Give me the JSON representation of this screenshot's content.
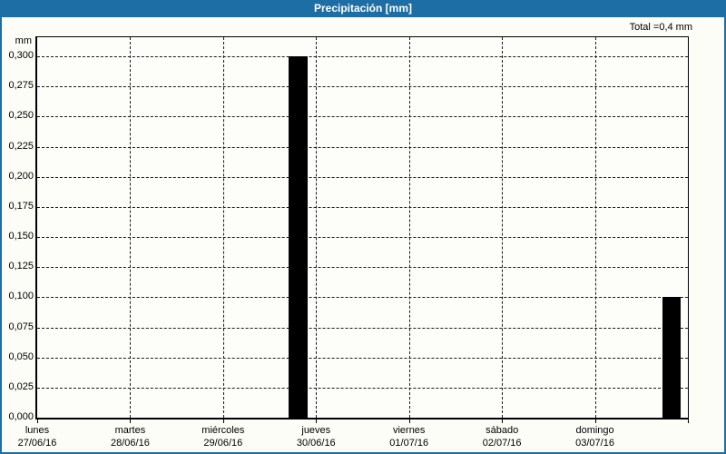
{
  "window": {
    "title": "Precipitación [mm]"
  },
  "colors": {
    "frame_blue": "#1c6ea4",
    "background": "#fbfdf6",
    "bar_color": "#000000",
    "grid_color": "#1a1a1a",
    "title_text": "#ffffff"
  },
  "chart_data": {
    "type": "bar",
    "title": "Precipitación [mm]",
    "total_label": "Total =0,4 mm",
    "total_value_mm": 0.4,
    "y_axis": {
      "unit_label": "mm",
      "min": 0.0,
      "max": 0.3,
      "tick_step": 0.025,
      "ticks": [
        {
          "value": 0.0,
          "label": "0,000"
        },
        {
          "value": 0.025,
          "label": "0,025"
        },
        {
          "value": 0.05,
          "label": "0,050"
        },
        {
          "value": 0.075,
          "label": "0,075"
        },
        {
          "value": 0.1,
          "label": "0,100"
        },
        {
          "value": 0.125,
          "label": "0,125"
        },
        {
          "value": 0.15,
          "label": "0,150"
        },
        {
          "value": 0.175,
          "label": "0,175"
        },
        {
          "value": 0.2,
          "label": "0,200"
        },
        {
          "value": 0.225,
          "label": "0,225"
        },
        {
          "value": 0.25,
          "label": "0,250"
        },
        {
          "value": 0.275,
          "label": "0,275"
        },
        {
          "value": 0.3,
          "label": "0,300"
        }
      ],
      "grid": "dashed"
    },
    "x_axis": {
      "days": [
        {
          "name": "lunes",
          "date": "27/06/16"
        },
        {
          "name": "martes",
          "date": "28/06/16"
        },
        {
          "name": "miércoles",
          "date": "29/06/16"
        },
        {
          "name": "jueves",
          "date": "30/06/16"
        },
        {
          "name": "viernes",
          "date": "01/07/16"
        },
        {
          "name": "sábado",
          "date": "02/07/16"
        },
        {
          "name": "domingo",
          "date": "03/07/16"
        }
      ],
      "grid": "dashed"
    },
    "bars": [
      {
        "value": 0.3,
        "x_frac": 0.3867,
        "width_frac": 0.0292,
        "near_label": "jueves 30/06/16"
      },
      {
        "value": 0.1,
        "x_frac": 0.9611,
        "width_frac": 0.0278,
        "near_label": "domingo 03/07/16 (right edge)"
      }
    ],
    "legend": "none"
  }
}
